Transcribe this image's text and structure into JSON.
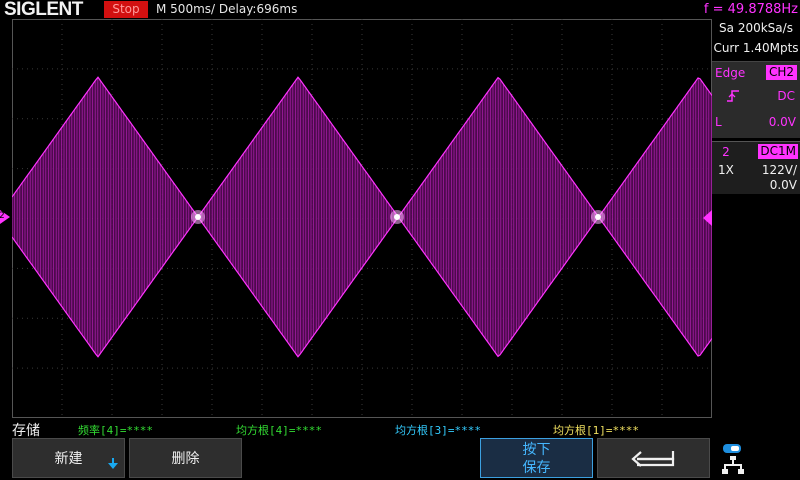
{
  "header": {
    "brand": "SIGLENT",
    "run_state": "Stop",
    "timebase": "M 500ms/",
    "delay": "Delay:696ms",
    "frequency": "f = 49.8788Hz"
  },
  "acquisition": {
    "sample_rate": "Sa 200kSa/s",
    "memory": "Curr 1.40Mpts"
  },
  "trigger": {
    "type_label": "Edge",
    "source": "CH2",
    "slope_icon": "rising-edge-icon",
    "coupling": "DC",
    "level_label": "L",
    "level_value": "0.0V"
  },
  "channel": {
    "number": "2",
    "coupling_badge": "DC1M",
    "probe": "1X",
    "scale": "122V/",
    "offset": "0.0V",
    "marker_label": "2"
  },
  "measurements": [
    {
      "label": "频率[4]=****",
      "color": "#33dd33"
    },
    {
      "label": "均方根[4]=****",
      "color": "#33dd33"
    },
    {
      "label": "均方根[3]=****",
      "color": "#33ccff"
    },
    {
      "label": "均方根[1]=****",
      "color": "#f0e060"
    }
  ],
  "menu": {
    "title": "存储",
    "new_button": "新建",
    "delete_button": "删除",
    "press_save_line1": "按下",
    "press_save_line2": "保存",
    "back_icon": "return-arrow-icon"
  },
  "colors": {
    "trace": "#ff33ff",
    "accent": "#19a9f0",
    "stop_badge": "#d21010"
  },
  "waveform": {
    "description_type": "amplitude-modulated envelope",
    "envelope_period_divs": 2.85
  }
}
